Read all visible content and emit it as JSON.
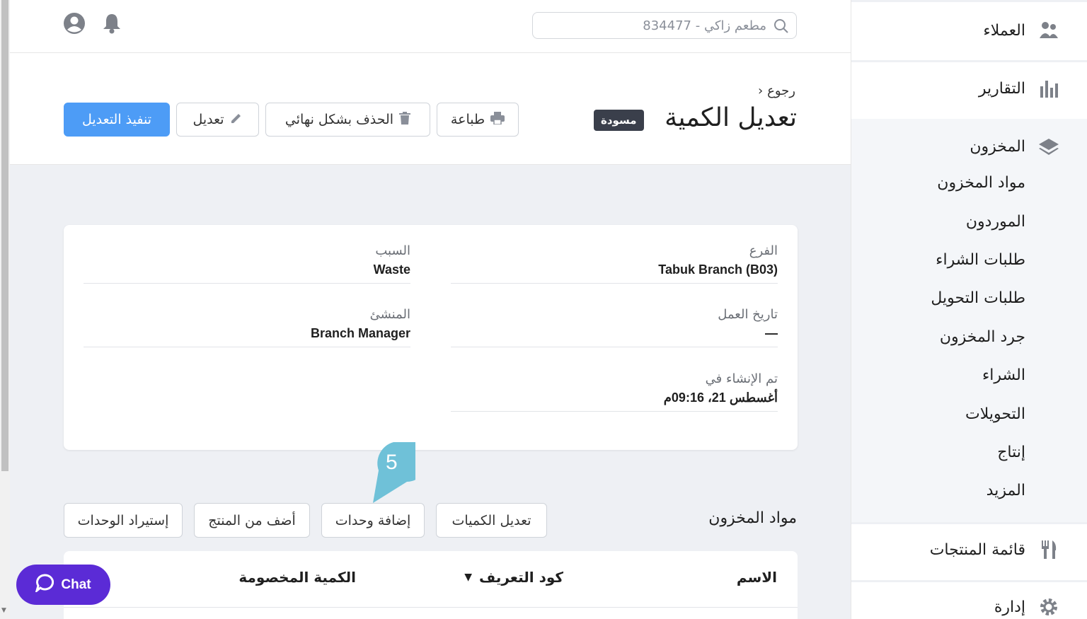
{
  "topbar": {
    "search_text": "مطعم زاكي - 834477"
  },
  "sidebar": {
    "items": [
      {
        "label": "العملاء",
        "icon": "customers-icon"
      },
      {
        "label": "التقارير",
        "icon": "reports-icon"
      },
      {
        "label": "المخزون",
        "icon": "inventory-layers-icon"
      },
      {
        "label": "قائمة المنتجات",
        "icon": "menu-fork-knife-icon"
      },
      {
        "label": "إدارة",
        "icon": "gear-icon"
      }
    ],
    "inventory_subitems": [
      "مواد المخزون",
      "الموردون",
      "طلبات الشراء",
      "طلبات التحويل",
      "جرد المخزون",
      "الشراء",
      "التحويلات",
      "إنتاج",
      "المزيد"
    ]
  },
  "header": {
    "back_label": "رجوع",
    "title": "تعديل الكمية",
    "status": "مسودة",
    "buttons": {
      "print": "طباعة",
      "delete": "الحذف بشكل نهائي",
      "edit": "تعديل",
      "submit": "تنفيذ التعديل"
    }
  },
  "details": {
    "branch_label": "الفرع",
    "branch_value": "Tabuk Branch (B03)",
    "reason_label": "السبب",
    "reason_value": "Waste",
    "business_date_label": "تاريخ العمل",
    "business_date_value": "—",
    "creator_label": "المنشئ",
    "creator_value": "Branch Manager",
    "created_at_label": "تم الإنشاء في",
    "created_at_value": "أغسطس 21، 09:16م"
  },
  "tooltip": {
    "step": "5"
  },
  "items_section": {
    "title": "مواد المخزون",
    "buttons": {
      "edit_quantities": "تعديل الكميات",
      "add_items": "إضافة وحدات",
      "add_from_product": "أضف من المنتج",
      "import_items": "إستيراد الوحدات"
    },
    "columns": [
      "الاسم",
      "كود التعريف",
      "الكمية المخصومة"
    ]
  },
  "chat": {
    "label": "Chat"
  },
  "colors": {
    "primary": "#4d9cf6",
    "chat": "#5b2bd6",
    "badge": "#3a3f4b",
    "bubble": "#6fc1d8"
  }
}
